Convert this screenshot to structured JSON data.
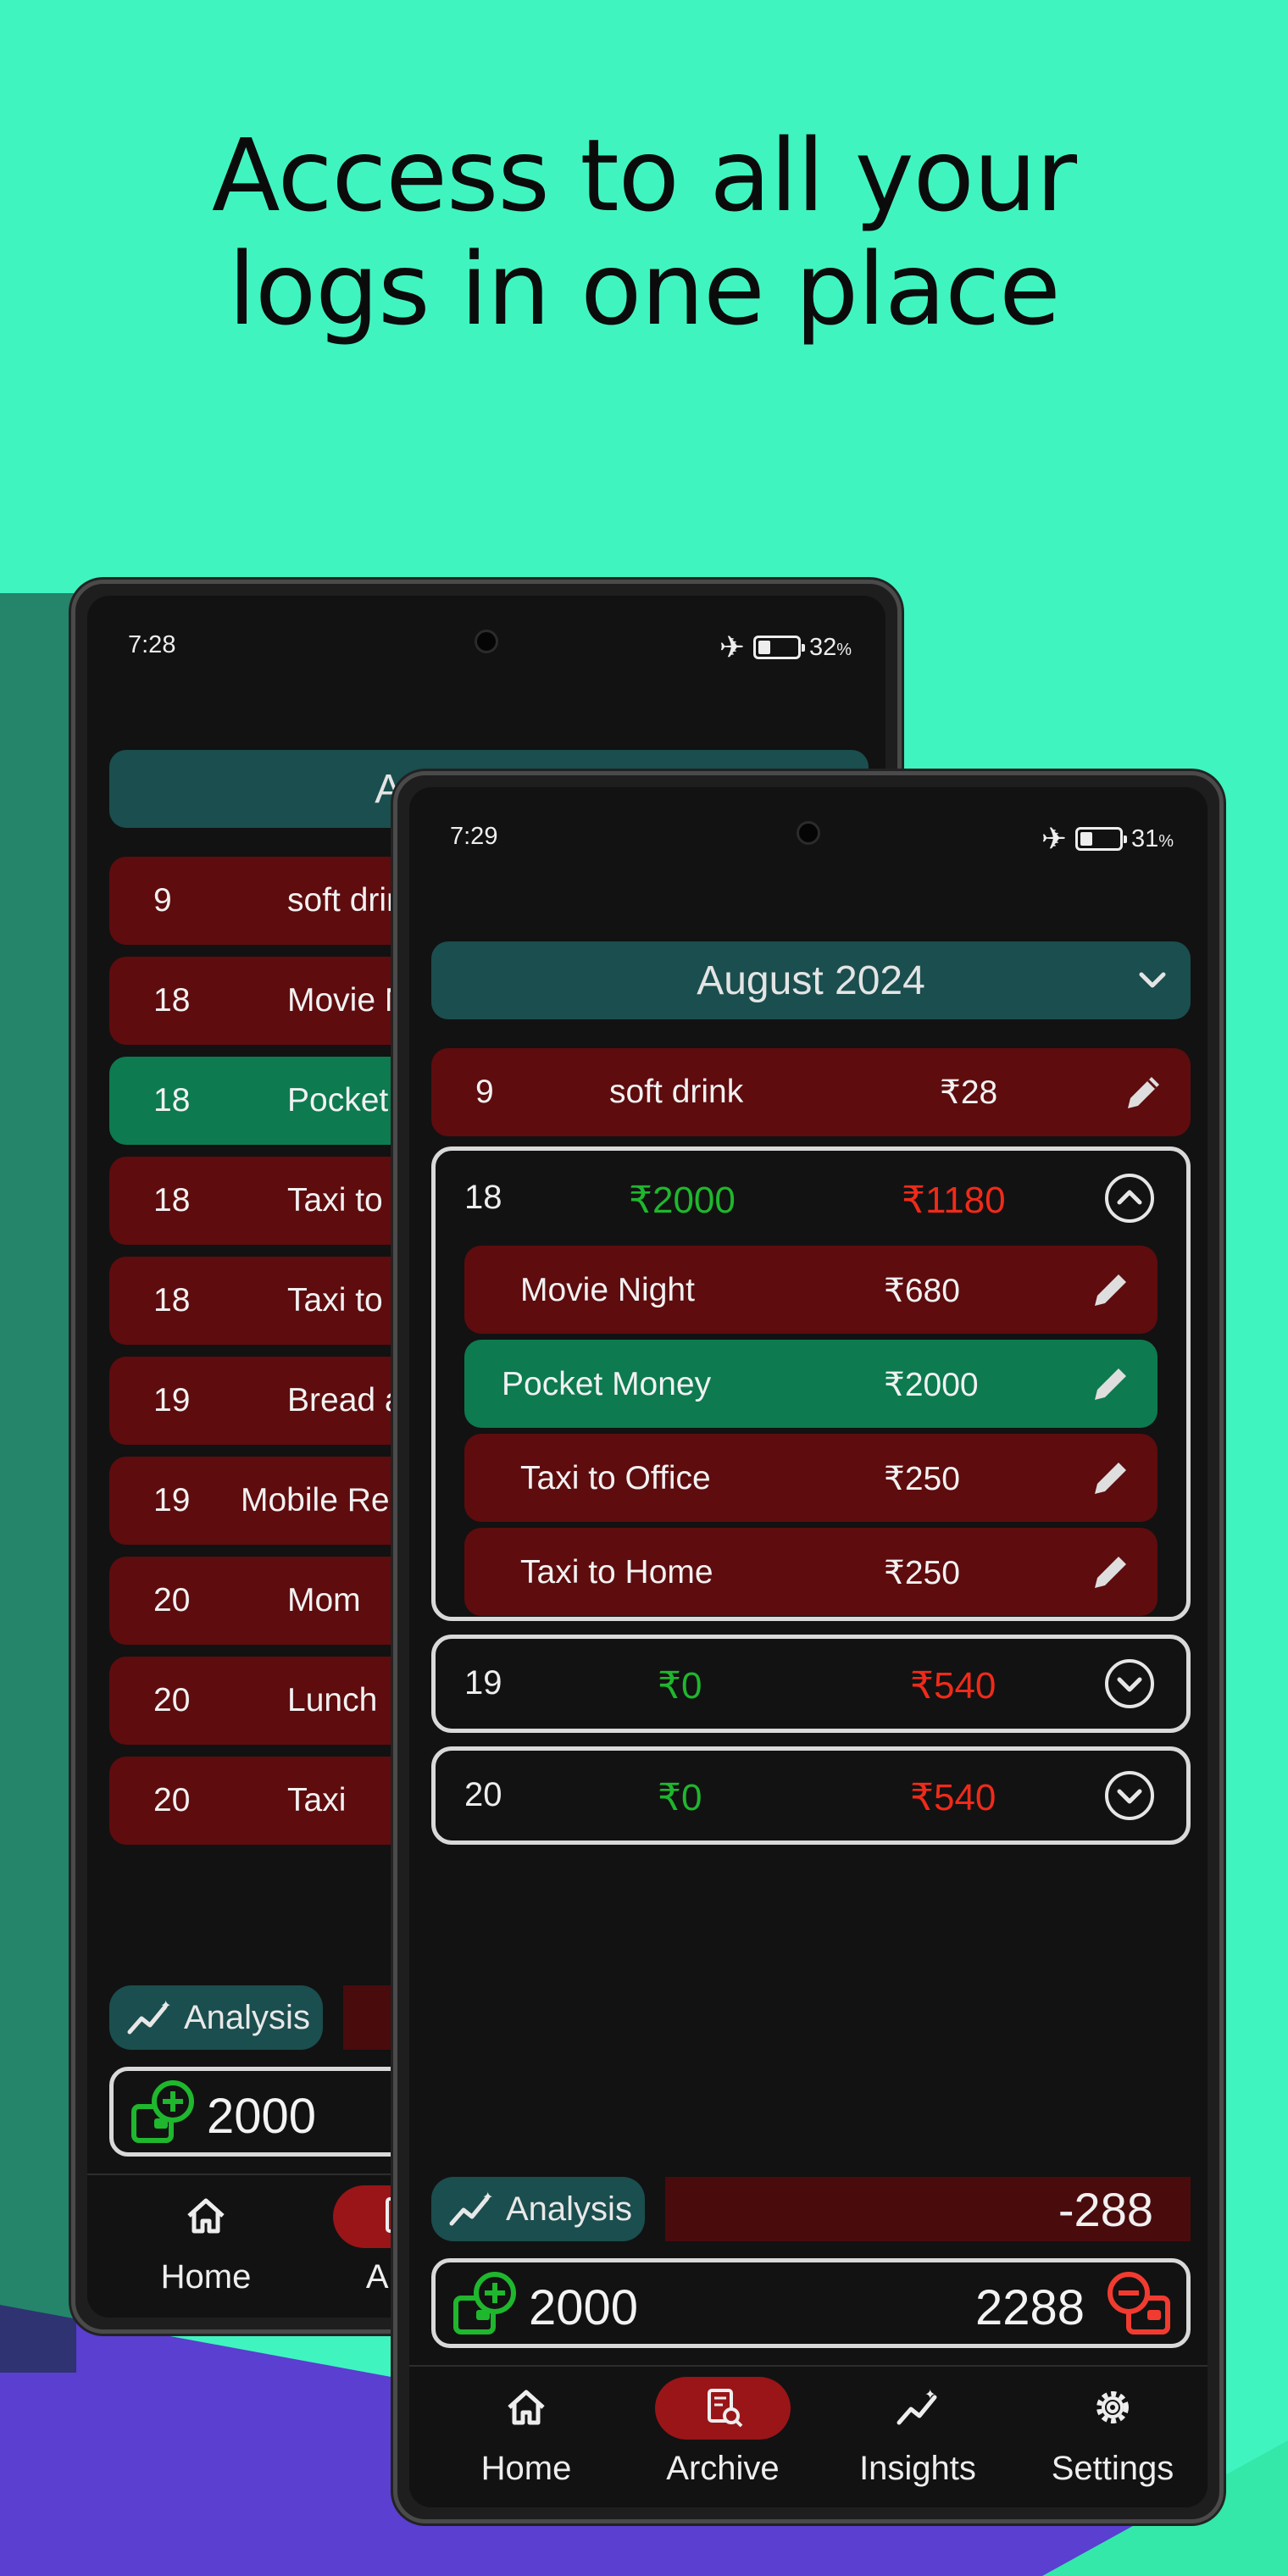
{
  "headline": {
    "line1": "Access to all your",
    "line2": "logs in one place"
  },
  "colors": {
    "background": "#40f4c0",
    "accent_teal": "#1b4e4e",
    "expense_red": "#5e0c0e",
    "income_green": "#0d7a50",
    "active_tab": "#9a1518",
    "purple": "#5a3fd0"
  },
  "back_phone": {
    "status": {
      "time": "7:28",
      "battery": "32",
      "battery_unit": "%"
    },
    "month": "August 2024",
    "entries": [
      {
        "day": "9",
        "name": "soft drink",
        "type": "expense"
      },
      {
        "day": "18",
        "name": "Movie Night",
        "type": "expense"
      },
      {
        "day": "18",
        "name": "Pocket Money",
        "type": "income"
      },
      {
        "day": "18",
        "name": "Taxi to Office",
        "type": "expense"
      },
      {
        "day": "18",
        "name": "Taxi to Home",
        "type": "expense"
      },
      {
        "day": "19",
        "name": "Bread and",
        "type": "expense"
      },
      {
        "day": "19",
        "name": "Mobile Re",
        "type": "expense"
      },
      {
        "day": "20",
        "name": "Mom",
        "type": "expense"
      },
      {
        "day": "20",
        "name": "Lunch",
        "type": "expense"
      },
      {
        "day": "20",
        "name": "Taxi",
        "type": "expense"
      }
    ],
    "analysis_label": "Analysis",
    "income_total": "2000",
    "nav": {
      "home": "Home",
      "archive": "Arch"
    }
  },
  "front_phone": {
    "status": {
      "time": "7:29",
      "battery": "31",
      "battery_unit": "%"
    },
    "month": "August 2024",
    "single_entry": {
      "day": "9",
      "name": "soft drink",
      "amount": "₹28"
    },
    "expanded_day": {
      "day": "18",
      "income": "₹2000",
      "expense": "₹1180",
      "items": [
        {
          "name": "Movie Night",
          "amount": "₹680",
          "type": "expense"
        },
        {
          "name": "Pocket Money",
          "amount": "₹2000",
          "type": "income"
        },
        {
          "name": "Taxi to Office",
          "amount": "₹250",
          "type": "expense"
        },
        {
          "name": "Taxi to Home",
          "amount": "₹250",
          "type": "expense"
        }
      ]
    },
    "collapsed_days": [
      {
        "day": "19",
        "income": "₹0",
        "expense": "₹540"
      },
      {
        "day": "20",
        "income": "₹0",
        "expense": "₹540"
      }
    ],
    "analysis_label": "Analysis",
    "net_balance": "-288",
    "income_total": "2000",
    "expense_total": "2288",
    "nav": {
      "home": "Home",
      "archive": "Archive",
      "insights": "Insights",
      "settings": "Settings",
      "active": "archive"
    }
  }
}
